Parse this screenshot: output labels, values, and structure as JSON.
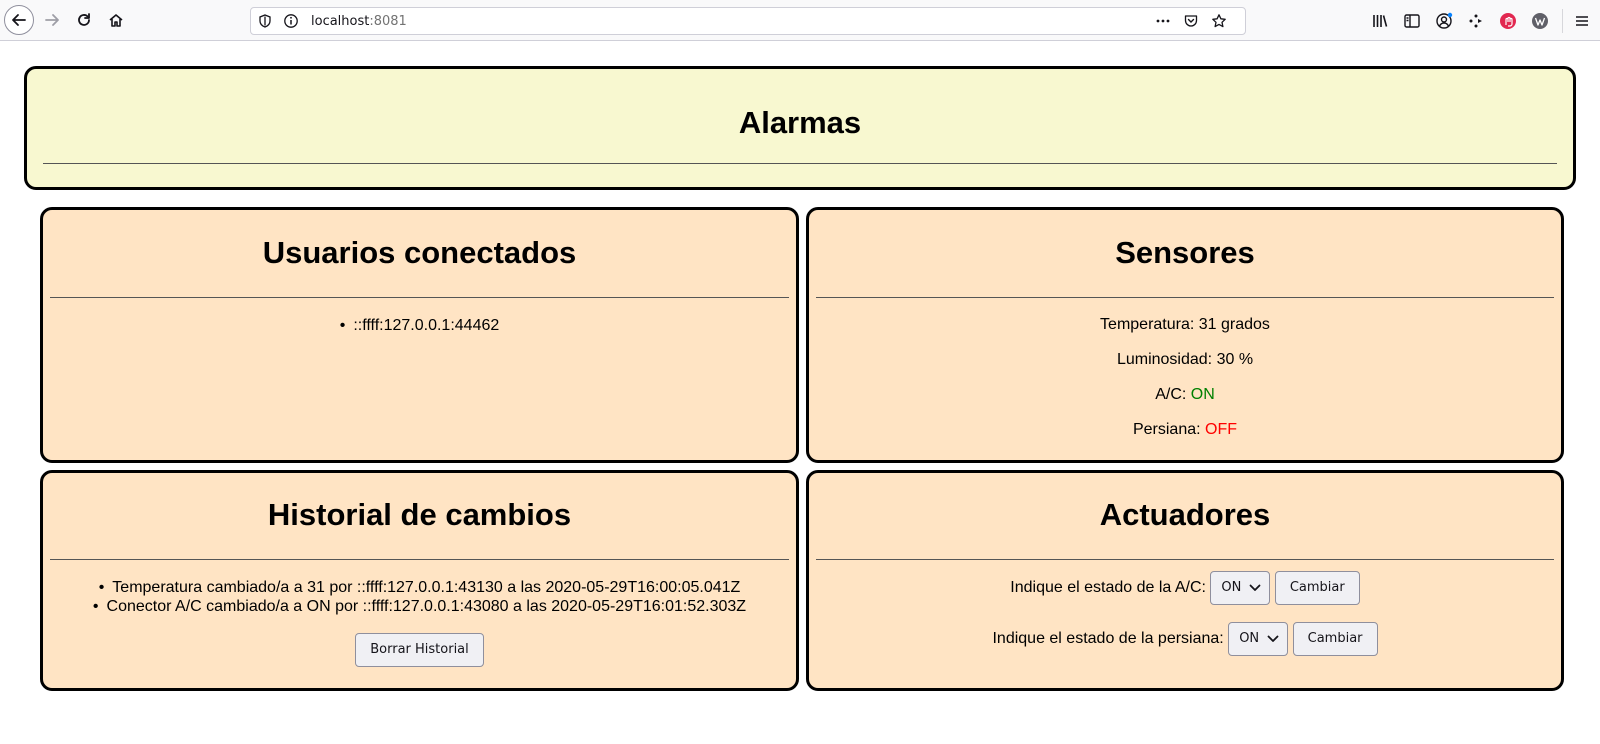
{
  "browser": {
    "url_host": "localhost",
    "url_port": ":8081"
  },
  "alarmas": {
    "title": "Alarmas"
  },
  "usuarios": {
    "title": "Usuarios conectados",
    "items": [
      "::ffff:127.0.0.1:44462"
    ]
  },
  "sensores": {
    "title": "Sensores",
    "temperatura_label": "Temperatura:",
    "temperatura_value": "31 grados",
    "luminosidad_label": "Luminosidad:",
    "luminosidad_value": "30 %",
    "ac_label": "A/C:",
    "ac_value": "ON",
    "persiana_label": "Persiana:",
    "persiana_value": "OFF",
    "colors": {
      "on": "#008000",
      "off": "#ff0000"
    }
  },
  "historial": {
    "title": "Historial de cambios",
    "items": [
      "Temperatura cambiado/a a 31 por ::ffff:127.0.0.1:43130 a las 2020-05-29T16:00:05.041Z",
      "Conector A/C cambiado/a a ON por ::ffff:127.0.0.1:43080 a las 2020-05-29T16:01:52.303Z"
    ],
    "clear_button": "Borrar Historial"
  },
  "actuadores": {
    "title": "Actuadores",
    "ac_prompt": "Indique el estado de la A/C:",
    "ac_selected": "ON",
    "ac_button": "Cambiar",
    "persiana_prompt": "Indique el estado de la persiana:",
    "persiana_selected": "ON",
    "persiana_button": "Cambiar"
  },
  "colors": {
    "alarm_bg": "#f8f8d0",
    "panel_bg": "#ffe4c4"
  }
}
